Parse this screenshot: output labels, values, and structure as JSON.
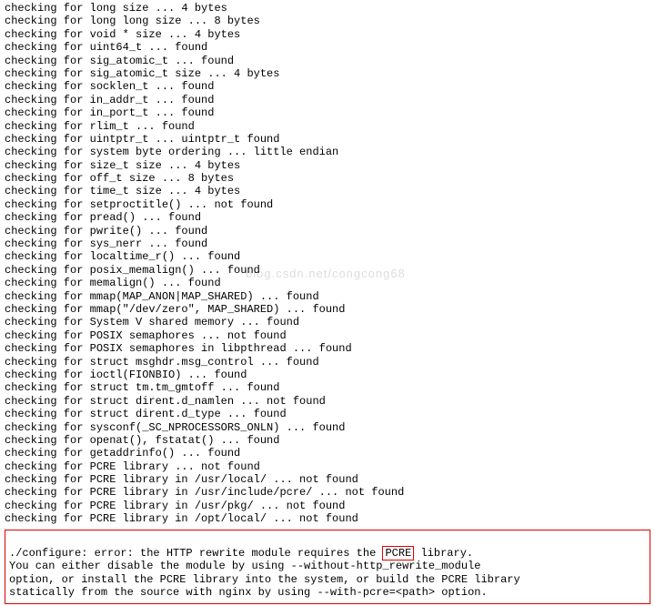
{
  "terminal": {
    "lines": [
      "checking for long size ... 4 bytes",
      "checking for long long size ... 8 bytes",
      "checking for void * size ... 4 bytes",
      "checking for uint64_t ... found",
      "checking for sig_atomic_t ... found",
      "checking for sig_atomic_t size ... 4 bytes",
      "checking for socklen_t ... found",
      "checking for in_addr_t ... found",
      "checking for in_port_t ... found",
      "checking for rlim_t ... found",
      "checking for uintptr_t ... uintptr_t found",
      "checking for system byte ordering ... little endian",
      "checking for size_t size ... 4 bytes",
      "checking for off_t size ... 8 bytes",
      "checking for time_t size ... 4 bytes",
      "checking for setproctitle() ... not found",
      "checking for pread() ... found",
      "checking for pwrite() ... found",
      "checking for sys_nerr ... found",
      "checking for localtime_r() ... found",
      "checking for posix_memalign() ... found",
      "checking for memalign() ... found",
      "checking for mmap(MAP_ANON|MAP_SHARED) ... found",
      "checking for mmap(\"/dev/zero\", MAP_SHARED) ... found",
      "checking for System V shared memory ... found",
      "checking for POSIX semaphores ... not found",
      "checking for POSIX semaphores in libpthread ... found",
      "checking for struct msghdr.msg_control ... found",
      "checking for ioctl(FIONBIO) ... found",
      "checking for struct tm.tm_gmtoff ... found",
      "checking for struct dirent.d_namlen ... not found",
      "checking for struct dirent.d_type ... found",
      "checking for sysconf(_SC_NPROCESSORS_ONLN) ... found",
      "checking for openat(), fstatat() ... found",
      "checking for getaddrinfo() ... found",
      "checking for PCRE library ... not found",
      "checking for PCRE library in /usr/local/ ... not found",
      "checking for PCRE library in /usr/include/pcre/ ... not found",
      "checking for PCRE library in /usr/pkg/ ... not found",
      "checking for PCRE library in /opt/local/ ... not found"
    ]
  },
  "error": {
    "prefix": "./configure: error: the HTTP rewrite module requires the ",
    "highlighted": "PCRE",
    "suffix1": " library.",
    "line2": "You can either disable the module by using --without-http_rewrite_module",
    "line3": "option, or install the PCRE library into the system, or build the PCRE library",
    "line4": "statically from the source with nginx by using --with-pcre=<path> option."
  },
  "watermark": "blog.csdn.net/congcong68"
}
